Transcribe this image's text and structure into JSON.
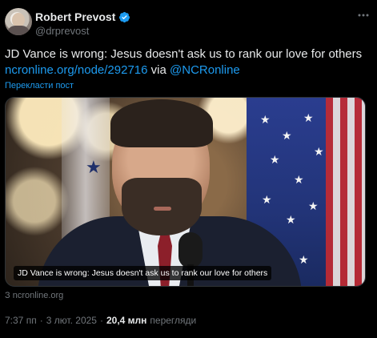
{
  "author": {
    "name": "Robert Prevost",
    "handle": "@drprevost"
  },
  "tweet": {
    "text": "JD Vance is wrong: Jesus doesn't ask us to rank our love for others",
    "link_url": "ncronline.org/node/292716",
    "via_word": "via",
    "mention": "@NCRonline",
    "translate_label": "Перекласти пост"
  },
  "media": {
    "caption": "JD Vance is wrong: Jesus doesn't ask us to rank our love for others",
    "source": "З ncronline.org"
  },
  "meta": {
    "time": "7:37 пп",
    "date": "3 лют. 2025",
    "separator": "·",
    "views_count": "20,4 млн",
    "views_label": "перегляди"
  },
  "colors": {
    "background": "#000000",
    "text": "#e7e9ea",
    "secondary": "#71767b",
    "link": "#1d9bf0",
    "verified": "#1d9bf0"
  },
  "icons": {
    "verified": "verified-badge-icon",
    "more": "more-horizontal-icon"
  }
}
